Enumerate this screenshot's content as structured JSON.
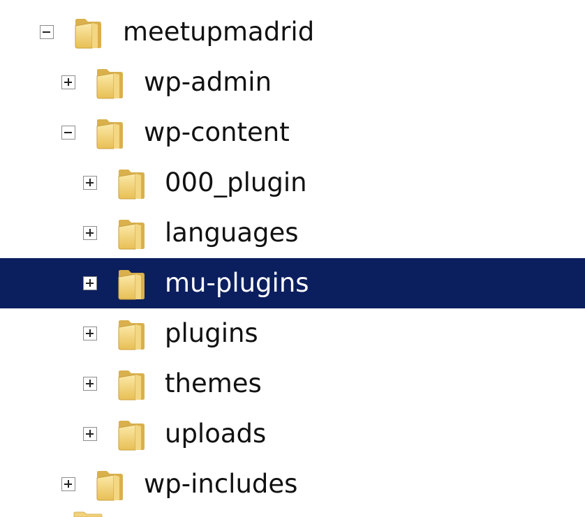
{
  "tree": {
    "nodes": [
      {
        "label": "meetupmadrid",
        "depth": 0,
        "expanded": true,
        "selected": false
      },
      {
        "label": "wp-admin",
        "depth": 1,
        "expanded": false,
        "selected": false
      },
      {
        "label": "wp-content",
        "depth": 1,
        "expanded": true,
        "selected": false
      },
      {
        "label": "000_plugin",
        "depth": 2,
        "expanded": false,
        "selected": false
      },
      {
        "label": "languages",
        "depth": 2,
        "expanded": false,
        "selected": false
      },
      {
        "label": "mu-plugins",
        "depth": 2,
        "expanded": false,
        "selected": true
      },
      {
        "label": "plugins",
        "depth": 2,
        "expanded": false,
        "selected": false
      },
      {
        "label": "themes",
        "depth": 2,
        "expanded": false,
        "selected": false
      },
      {
        "label": "uploads",
        "depth": 2,
        "expanded": false,
        "selected": false
      },
      {
        "label": "wp-includes",
        "depth": 1,
        "expanded": false,
        "selected": false
      }
    ]
  },
  "colors": {
    "selection": "#0b1e5e",
    "folder": "#f2d27a"
  }
}
